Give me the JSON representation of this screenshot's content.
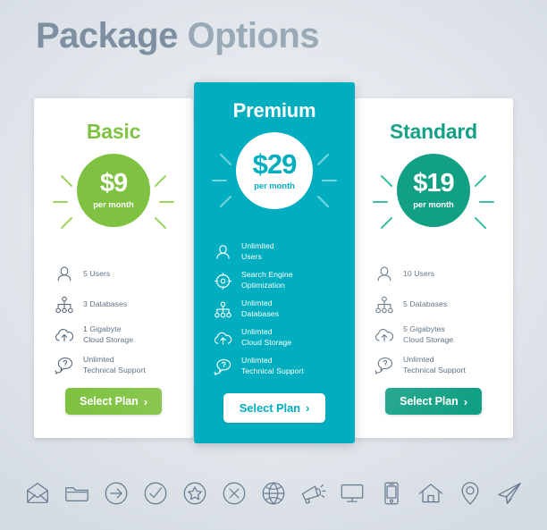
{
  "title": {
    "strong": "Package",
    "light": " Options"
  },
  "colors": {
    "background": "#dee3e9",
    "title_strong": "#7d8fa0",
    "title_light": "#9aa9b6",
    "basic_green": "#7fc241",
    "premium_teal": "#00aec0",
    "standard_emerald": "#12a085",
    "feature_text": "#52687d",
    "card_white": "#ffffff",
    "strip_icon": "#64798e"
  },
  "plans": [
    {
      "id": "basic",
      "name": "Basic",
      "price": "$9",
      "period": "per month",
      "accent": "#7fc241",
      "featured": false,
      "features": [
        {
          "icon": "user-icon",
          "text": "5 Users"
        },
        {
          "icon": "database-tree-icon",
          "text": "3 Databases"
        },
        {
          "icon": "cloud-upload-icon",
          "text": "1 Gigabyte\nCloud Storage"
        },
        {
          "icon": "support-chat-icon",
          "text": "Unlimted\nTechnical Support"
        }
      ],
      "button_label": "Select Plan",
      "button_chevron": "›"
    },
    {
      "id": "premium",
      "name": "Premium",
      "price": "$29",
      "period": "per month",
      "accent": "#00aec0",
      "featured": true,
      "features": [
        {
          "icon": "user-icon",
          "text": "Unlimited\nUsers"
        },
        {
          "icon": "seo-target-icon",
          "text": "Search Engine\nOptimization"
        },
        {
          "icon": "database-tree-icon",
          "text": "Unlimted\nDatabases"
        },
        {
          "icon": "cloud-upload-icon",
          "text": "Unlimted\nCloud Storage"
        },
        {
          "icon": "support-chat-icon",
          "text": "Unlimted\nTechnical Support"
        }
      ],
      "button_label": "Select Plan",
      "button_chevron": "›"
    },
    {
      "id": "standard",
      "name": "Standard",
      "price": "$19",
      "period": "per month",
      "accent": "#12a085",
      "featured": false,
      "features": [
        {
          "icon": "user-icon",
          "text": "10 Users"
        },
        {
          "icon": "database-tree-icon",
          "text": "5 Databases"
        },
        {
          "icon": "cloud-upload-icon",
          "text": "5 Gigabytes\nCloud Storage"
        },
        {
          "icon": "support-chat-icon",
          "text": "Unlimted\nTechnical Support"
        }
      ],
      "button_label": "Select Plan",
      "button_chevron": "›"
    }
  ],
  "icon_strip": [
    "envelope-icon",
    "folder-icon",
    "arrow-right-circle-icon",
    "check-circle-icon",
    "star-circle-icon",
    "x-circle-icon",
    "globe-icon",
    "megaphone-icon",
    "monitor-icon",
    "smartphone-icon",
    "home-icon",
    "location-pin-icon",
    "paper-plane-icon"
  ]
}
